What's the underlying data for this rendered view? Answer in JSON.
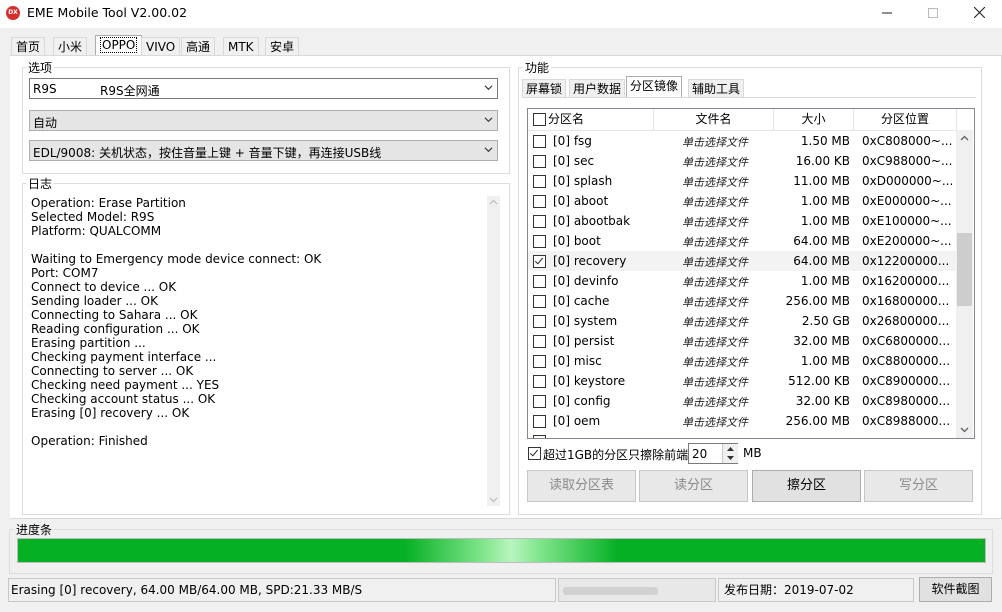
{
  "window": {
    "title": "EME Mobile Tool V2.00.02",
    "icon_text": "DX",
    "minimize_icon": "minimize-icon",
    "maximize_icon": "maximize-icon",
    "close_icon": "close-icon"
  },
  "top_tabs": [
    "首页",
    "小米",
    "OPPO",
    "VIVO",
    "高通",
    "MTK",
    "安卓"
  ],
  "active_top_tab": "OPPO",
  "options": {
    "group_label": "选项",
    "model_select": {
      "model": "R9S",
      "name": "R9S全网通"
    },
    "mode_select": "自动",
    "edl_select": "EDL/9008: 关机状态，按住音量上键 + 音量下键，再连接USB线"
  },
  "log": {
    "group_label": "日志",
    "lines": [
      "Operation: Erase Partition",
      "Selected Model:  R9S",
      "Platform:  QUALCOMM",
      "",
      "Waiting to Emergency mode device connect: OK",
      "Port: COM7",
      "Connect to device ... OK",
      "Sending loader ... OK",
      "Connecting to Sahara ... OK",
      "Reading configuration ... OK",
      "Erasing partition ...",
      "Checking payment interface ...",
      "Connecting to server ... OK",
      "Checking need payment ... YES",
      "Checking account status ... OK",
      "Erasing [0] recovery ... OK",
      "",
      "Operation: Finished"
    ]
  },
  "function": {
    "group_label": "功能",
    "tabs": [
      "屏幕锁",
      "用户数据",
      "分区镜像",
      "辅助工具"
    ],
    "active_tab": "分区镜像"
  },
  "partition_table": {
    "headers": [
      "分区名",
      "文件名",
      "大小",
      "分区位置"
    ],
    "rows": [
      {
        "name": "[0] fsg",
        "file": "单击选择文件",
        "size": "1.50 MB",
        "pos": "0xC808000~...",
        "checked": false
      },
      {
        "name": "[0] sec",
        "file": "单击选择文件",
        "size": "16.00 KB",
        "pos": "0xC988000~...",
        "checked": false
      },
      {
        "name": "[0] splash",
        "file": "单击选择文件",
        "size": "11.00 MB",
        "pos": "0xD000000~...",
        "checked": false
      },
      {
        "name": "[0] aboot",
        "file": "单击选择文件",
        "size": "1.00 MB",
        "pos": "0xE000000~...",
        "checked": false
      },
      {
        "name": "[0] abootbak",
        "file": "单击选择文件",
        "size": "1.00 MB",
        "pos": "0xE100000~...",
        "checked": false
      },
      {
        "name": "[0] boot",
        "file": "单击选择文件",
        "size": "64.00 MB",
        "pos": "0xE200000~...",
        "checked": false
      },
      {
        "name": "[0] recovery",
        "file": "单击选择文件",
        "size": "64.00 MB",
        "pos": "0x12200000...",
        "checked": true
      },
      {
        "name": "[0] devinfo",
        "file": "单击选择文件",
        "size": "1.00 MB",
        "pos": "0x16200000...",
        "checked": false
      },
      {
        "name": "[0] cache",
        "file": "单击选择文件",
        "size": "256.00 MB",
        "pos": "0x16800000...",
        "checked": false
      },
      {
        "name": "[0] system",
        "file": "单击选择文件",
        "size": "2.50 GB",
        "pos": "0x26800000...",
        "checked": false
      },
      {
        "name": "[0] persist",
        "file": "单击选择文件",
        "size": "32.00 MB",
        "pos": "0xC6800000...",
        "checked": false
      },
      {
        "name": "[0] misc",
        "file": "单击选择文件",
        "size": "1.00 MB",
        "pos": "0xC8800000...",
        "checked": false
      },
      {
        "name": "[0] keystore",
        "file": "单击选择文件",
        "size": "512.00 KB",
        "pos": "0xC8900000...",
        "checked": false
      },
      {
        "name": "[0] config",
        "file": "单击选择文件",
        "size": "32.00 KB",
        "pos": "0xC8980000...",
        "checked": false
      },
      {
        "name": "[0] oem",
        "file": "单击选择文件",
        "size": "256.00 MB",
        "pos": "0xC8988000...",
        "checked": false
      }
    ]
  },
  "erase_option": {
    "label": "超过1GB的分区只擦除前端",
    "value": "20",
    "unit": "MB",
    "checked": true
  },
  "buttons": {
    "read_table": "读取分区表",
    "read_partition": "读分区",
    "erase_partition": "擦分区",
    "write_partition": "写分区"
  },
  "progress": {
    "label": "进度条",
    "percent": 100
  },
  "status": {
    "message": "Erasing [0] recovery, 64.00 MB/64.00 MB, SPD:21.33 MB/S",
    "release_date": "发布日期：2019-07-02",
    "screenshot_button": "软件截图"
  }
}
